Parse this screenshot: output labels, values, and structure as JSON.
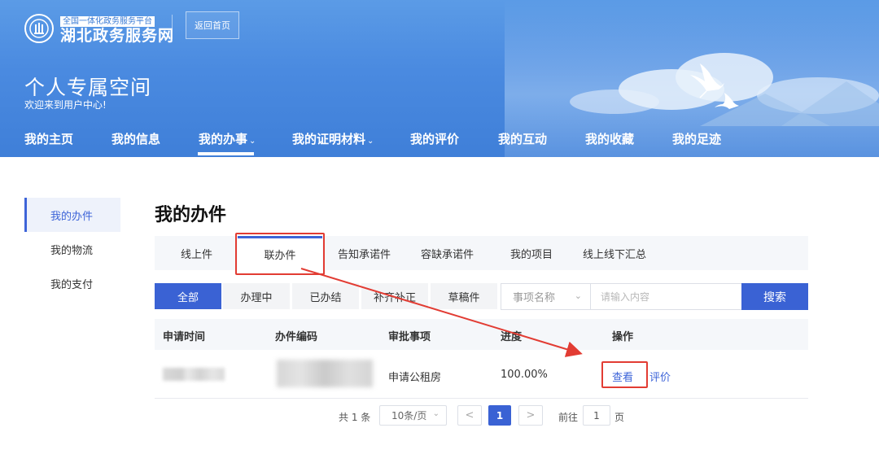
{
  "header": {
    "logo_sub": "全国一体化政务服务平台",
    "logo_main": "湖北政务服务网",
    "home_button": "返回首页",
    "space_title": "个人专属空间",
    "space_welcome": "欢迎来到用户中心!"
  },
  "nav": {
    "items": [
      {
        "label": "我的主页"
      },
      {
        "label": "我的信息"
      },
      {
        "label": "我的办事",
        "chevron": "⌄",
        "active": true
      },
      {
        "label": "我的证明材料",
        "chevron": "⌄"
      },
      {
        "label": "我的评价"
      },
      {
        "label": "我的互动"
      },
      {
        "label": "我的收藏"
      },
      {
        "label": "我的足迹"
      }
    ]
  },
  "sidebar": {
    "items": [
      {
        "label": "我的办件",
        "active": true
      },
      {
        "label": "我的物流"
      },
      {
        "label": "我的支付"
      }
    ]
  },
  "main": {
    "title": "我的办件",
    "tabs": [
      {
        "label": "线上件"
      },
      {
        "label": "联办件",
        "active": true
      },
      {
        "label": "告知承诺件"
      },
      {
        "label": "容缺承诺件"
      },
      {
        "label": "我的项目"
      },
      {
        "label": "线上线下汇总"
      }
    ],
    "filters": [
      {
        "label": "全部",
        "active": true
      },
      {
        "label": "办理中"
      },
      {
        "label": "已办结"
      },
      {
        "label": "补齐补正"
      },
      {
        "label": "草稿件"
      }
    ],
    "search": {
      "select_value": "事项名称",
      "placeholder": "请输入内容",
      "button": "搜索"
    },
    "table": {
      "columns": [
        "申请时间",
        "办件编码",
        "审批事项",
        "进度",
        "操作"
      ],
      "rows": [
        {
          "apply_time": "",
          "code": "",
          "item": "申请公租房",
          "progress": "100.00%",
          "action_view": "查看",
          "action_rate": "评价"
        }
      ]
    },
    "pagination": {
      "total": "共 1 条",
      "page_size": "10条/页",
      "prev": "<",
      "next": ">",
      "current": "1",
      "goto_label": "前往",
      "goto_value": "1",
      "goto_unit": "页"
    }
  },
  "colors": {
    "brand_blue": "#3a62d4",
    "banner_blue": "#4a8ae0",
    "annotation_red": "#e23c33"
  }
}
